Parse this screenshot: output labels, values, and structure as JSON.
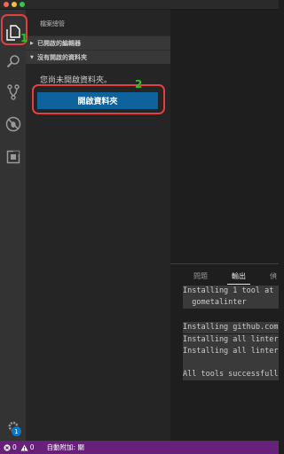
{
  "sidebar": {
    "title": "檔案總管",
    "sections": [
      {
        "label": "已開啟的編輯器",
        "expanded": false
      },
      {
        "label": "沒有開啟的資料夾",
        "expanded": true
      }
    ],
    "empty_message": "您尚未開啟資料夾。",
    "open_folder_button": "開啟資料夾"
  },
  "activity_bar": {
    "items": [
      "files-icon",
      "search-icon",
      "source-control-icon",
      "debug-icon",
      "extensions-icon"
    ],
    "settings_badge": "1"
  },
  "panel": {
    "tabs": [
      "問題",
      "輸出",
      "偵"
    ],
    "active_tab": "輸出",
    "output_lines": [
      "Installing 1 tool at",
      "  gometalinter",
      "",
      "Installing github.com",
      "Installing all linter",
      "Installing all linter",
      "",
      "All tools successfull"
    ]
  },
  "status_bar": {
    "errors": "0",
    "warnings": "0",
    "auto_attach": "自動附加: 關"
  },
  "annotations": [
    {
      "number": "1"
    },
    {
      "number": "2"
    }
  ],
  "colors": {
    "status_bar": "#68217a",
    "button": "#0e639c",
    "annotation_box": "#e04040",
    "annotation_number": "#22cc22"
  }
}
